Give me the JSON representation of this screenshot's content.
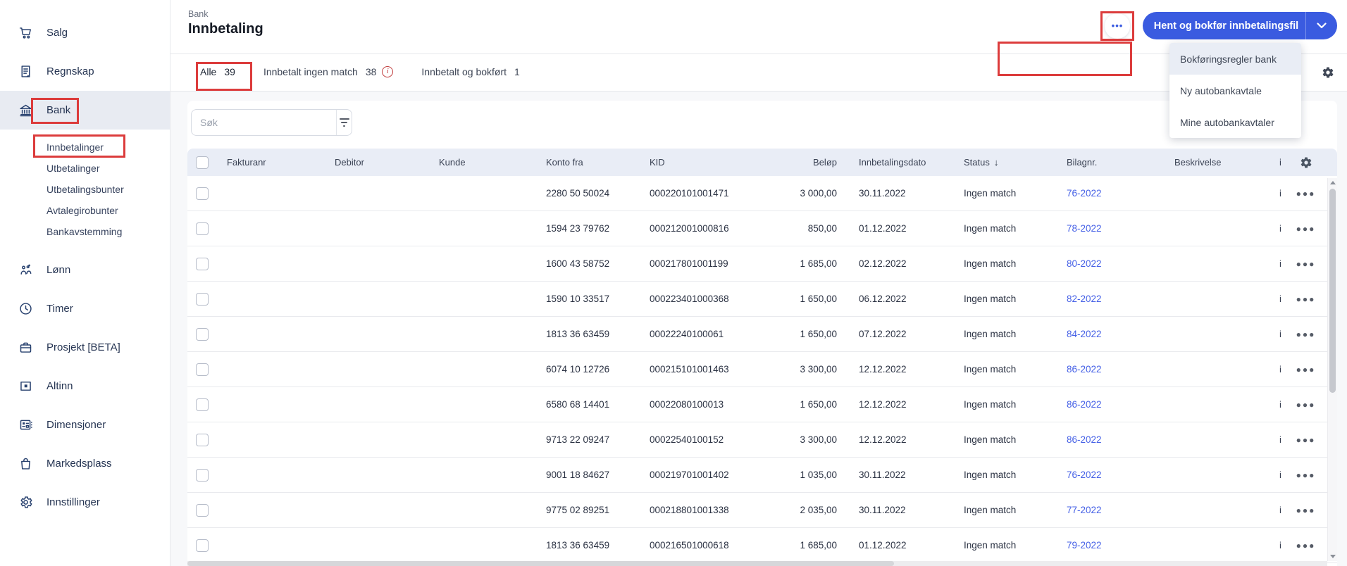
{
  "colors": {
    "accent_blue": "#3a5be0",
    "link_blue": "#4560e6",
    "annotation_red": "#dc3c3c",
    "sidebar_navy": "#27406e",
    "table_header_bg": "#e9edf6",
    "active_tab_underline": "#1e3a5f"
  },
  "sidebar": {
    "items": [
      {
        "label": "Salg",
        "icon": "cart-icon"
      },
      {
        "label": "Regnskap",
        "icon": "ledger-icon"
      },
      {
        "label": "Bank",
        "icon": "bank-icon",
        "active": true,
        "children": [
          "Innbetalinger",
          "Utbetalinger",
          "Utbetalingsbunter",
          "Avtalegirobunter",
          "Bankavstemming"
        ]
      },
      {
        "label": "Lønn",
        "icon": "people-icon"
      },
      {
        "label": "Timer",
        "icon": "clock-icon"
      },
      {
        "label": "Prosjekt [BETA]",
        "icon": "briefcase-icon"
      },
      {
        "label": "Altinn",
        "icon": "altinn-icon"
      },
      {
        "label": "Dimensjoner",
        "icon": "dimensions-icon"
      },
      {
        "label": "Markedsplass",
        "icon": "bag-icon"
      },
      {
        "label": "Innstillinger",
        "icon": "gear-icon"
      }
    ]
  },
  "header": {
    "breadcrumb": "Bank",
    "title": "Innbetaling",
    "more_button_dots": "•••",
    "primary_button_label": "Hent og bokfør innbetalingsfil"
  },
  "menu": {
    "items": [
      "Bokføringsregler bank",
      "Ny autobankavtale",
      "Mine autobankavtaler"
    ],
    "highlighted_index": 0
  },
  "tabs": [
    {
      "label": "Alle",
      "count": "39",
      "active": true
    },
    {
      "label": "Innbetalt ingen match",
      "count": "38",
      "info_icon": true
    },
    {
      "label": "Innbetalt og bokført",
      "count": "1"
    }
  ],
  "search": {
    "placeholder": "Søk"
  },
  "table": {
    "columns": [
      "Fakturanr",
      "Debitor",
      "Kunde",
      "Konto fra",
      "KID",
      "Beløp",
      "Innbetalingsdato",
      "Status",
      "Bilagnr.",
      "Beskrivelse"
    ],
    "sort_column": "Status",
    "sort_arrow": "↓",
    "clipped_fragment": "i",
    "rows": [
      {
        "fakturanr": "",
        "debitor": "",
        "kunde": "",
        "konto_fra": "2280 50 50024",
        "kid": "000220101001471",
        "belop": "3 000,00",
        "innbetalingsdato": "30.11.2022",
        "status": "Ingen match",
        "bilagnr": "76-2022",
        "beskrivelse": ""
      },
      {
        "fakturanr": "",
        "debitor": "",
        "kunde": "",
        "konto_fra": "1594 23 79762",
        "kid": "000212001000816",
        "belop": "850,00",
        "innbetalingsdato": "01.12.2022",
        "status": "Ingen match",
        "bilagnr": "78-2022",
        "beskrivelse": ""
      },
      {
        "fakturanr": "",
        "debitor": "",
        "kunde": "",
        "konto_fra": "1600 43 58752",
        "kid": "000217801001199",
        "belop": "1 685,00",
        "innbetalingsdato": "02.12.2022",
        "status": "Ingen match",
        "bilagnr": "80-2022",
        "beskrivelse": ""
      },
      {
        "fakturanr": "",
        "debitor": "",
        "kunde": "",
        "konto_fra": "1590 10 33517",
        "kid": "000223401000368",
        "belop": "1 650,00",
        "innbetalingsdato": "06.12.2022",
        "status": "Ingen match",
        "bilagnr": "82-2022",
        "beskrivelse": ""
      },
      {
        "fakturanr": "",
        "debitor": "",
        "kunde": "",
        "konto_fra": "1813 36 63459",
        "kid": "00022240100061",
        "belop": "1 650,00",
        "innbetalingsdato": "07.12.2022",
        "status": "Ingen match",
        "bilagnr": "84-2022",
        "beskrivelse": ""
      },
      {
        "fakturanr": "",
        "debitor": "",
        "kunde": "",
        "konto_fra": "6074 10 12726",
        "kid": "000215101001463",
        "belop": "3 300,00",
        "innbetalingsdato": "12.12.2022",
        "status": "Ingen match",
        "bilagnr": "86-2022",
        "beskrivelse": ""
      },
      {
        "fakturanr": "",
        "debitor": "",
        "kunde": "",
        "konto_fra": "6580 68 14401",
        "kid": "00022080100013",
        "belop": "1 650,00",
        "innbetalingsdato": "12.12.2022",
        "status": "Ingen match",
        "bilagnr": "86-2022",
        "beskrivelse": ""
      },
      {
        "fakturanr": "",
        "debitor": "",
        "kunde": "",
        "konto_fra": "9713 22 09247",
        "kid": "00022540100152",
        "belop": "3 300,00",
        "innbetalingsdato": "12.12.2022",
        "status": "Ingen match",
        "bilagnr": "86-2022",
        "beskrivelse": ""
      },
      {
        "fakturanr": "",
        "debitor": "",
        "kunde": "",
        "konto_fra": "9001 18 84627",
        "kid": "000219701001402",
        "belop": "1 035,00",
        "innbetalingsdato": "30.11.2022",
        "status": "Ingen match",
        "bilagnr": "76-2022",
        "beskrivelse": ""
      },
      {
        "fakturanr": "",
        "debitor": "",
        "kunde": "",
        "konto_fra": "9775 02 89251",
        "kid": "000218801001338",
        "belop": "2 035,00",
        "innbetalingsdato": "30.11.2022",
        "status": "Ingen match",
        "bilagnr": "77-2022",
        "beskrivelse": ""
      },
      {
        "fakturanr": "",
        "debitor": "",
        "kunde": "",
        "konto_fra": "1813 36 63459",
        "kid": "000216501000618",
        "belop": "1 685,00",
        "innbetalingsdato": "01.12.2022",
        "status": "Ingen match",
        "bilagnr": "79-2022",
        "beskrivelse": ""
      }
    ]
  }
}
